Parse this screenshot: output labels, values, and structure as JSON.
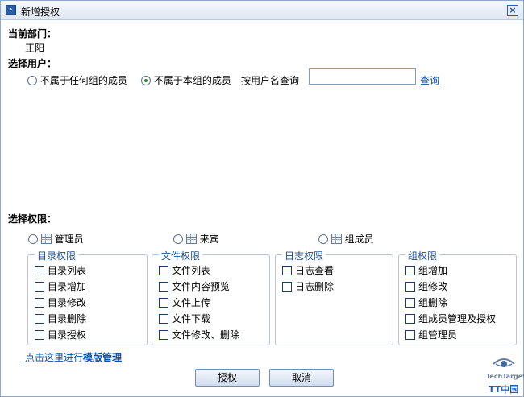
{
  "window": {
    "title": "新增授权",
    "close_glyph": "×"
  },
  "department": {
    "label": "当前部门：",
    "value": "正阳"
  },
  "user_select": {
    "label": "选择用户：",
    "options": [
      {
        "label": "不属于任何组的成员",
        "selected": false
      },
      {
        "label": "不属于本组的成员",
        "selected": true
      }
    ],
    "search_label": "按用户名查询",
    "search_value": "",
    "search_placeholder": "",
    "query_link": "查询"
  },
  "permissions": {
    "label": "选择权限：",
    "roles": [
      {
        "label": "管理员",
        "icon": "grid-icon",
        "selected": false
      },
      {
        "label": "来宾",
        "icon": "grid-icon",
        "selected": false
      },
      {
        "label": "组成员",
        "icon": "grid-icon",
        "selected": false
      }
    ],
    "groups": [
      {
        "title": "目录权限",
        "items": [
          "目录列表",
          "目录增加",
          "目录修改",
          "目录删除",
          "目录授权"
        ]
      },
      {
        "title": "文件权限",
        "items": [
          "文件列表",
          "文件内容预览",
          "文件上传",
          "文件下载",
          "文件修改、删除"
        ]
      },
      {
        "title": "日志权限",
        "items": [
          "日志查看",
          "日志删除"
        ]
      },
      {
        "title": "组权限",
        "items": [
          "组增加",
          "组修改",
          "组删除",
          "组成员管理及授权",
          "组管理员"
        ]
      }
    ]
  },
  "template_link": {
    "prefix": "点击这里进行",
    "bold": "模版管理"
  },
  "buttons": {
    "authorize": "授权",
    "cancel": "取消"
  },
  "watermark": {
    "line1": "TechTarget",
    "line2": "TT中国"
  },
  "colors": {
    "accent": "#1f4f8f",
    "link": "#0a4fa8"
  }
}
